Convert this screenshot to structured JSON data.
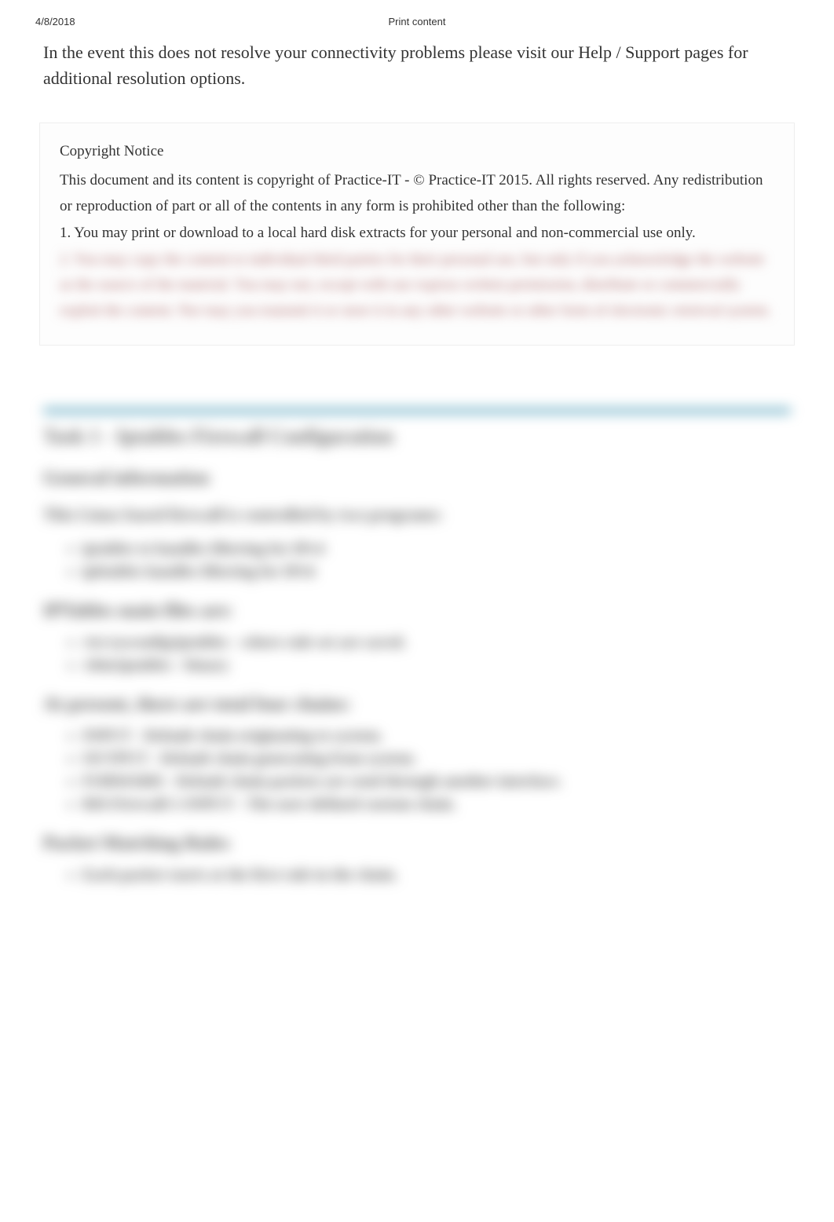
{
  "header": {
    "date": "4/8/2018",
    "title": "Print content"
  },
  "intro": "In the event this does not resolve your connectivity problems please visit our Help / Support pages for additional resolution options.",
  "copyright": {
    "title": "Copyright Notice",
    "body": " This document and its content is copyright of Practice-IT - © Practice-IT 2015. All rights reserved. Any redistribution or reproduction of part or all of the contents in any form is prohibited other than the following:",
    "item1": " 1. You may print or download to a local hard disk extracts for your personal and non-commercial use only.",
    "item2_blurred": "2. You may copy the content to individual third parties for their personal use, but only if you acknowledge the website as the source of the material. You may not, except with our express written permission, distribute or commercially exploit the content. Nor may you transmit it or store it in any other website or other form of electronic retrieval system."
  },
  "blurred": {
    "task_title": "Task 1 - Iptables Firewall Configuration",
    "h_general": "General information",
    "p_linux": "This Linux based firewall is controlled by two programs:",
    "programs": [
      "iptables to handles filtering for IPv4",
      "ip6tables handles filtering for IPv6"
    ],
    "h_mainfiles": "IPTables main files are:",
    "files": [
      "/etc/sysconfig/iptables - where rule set are saved.",
      "/sbin/iptables - binary"
    ],
    "h_chains": "At present, there are total four chains:",
    "chains": [
      "INPUT - Default chain originating to system.",
      "OUTPUT - Default chain generating from system.",
      "FORWARD - Default chain packets are send through another interface.",
      "RH-Firewall-1-INPUT - The user-defined custom chain."
    ],
    "h_rules": "Packet Matching Rules",
    "rules": [
      "Each packet starts at the first rule in the chain."
    ]
  }
}
